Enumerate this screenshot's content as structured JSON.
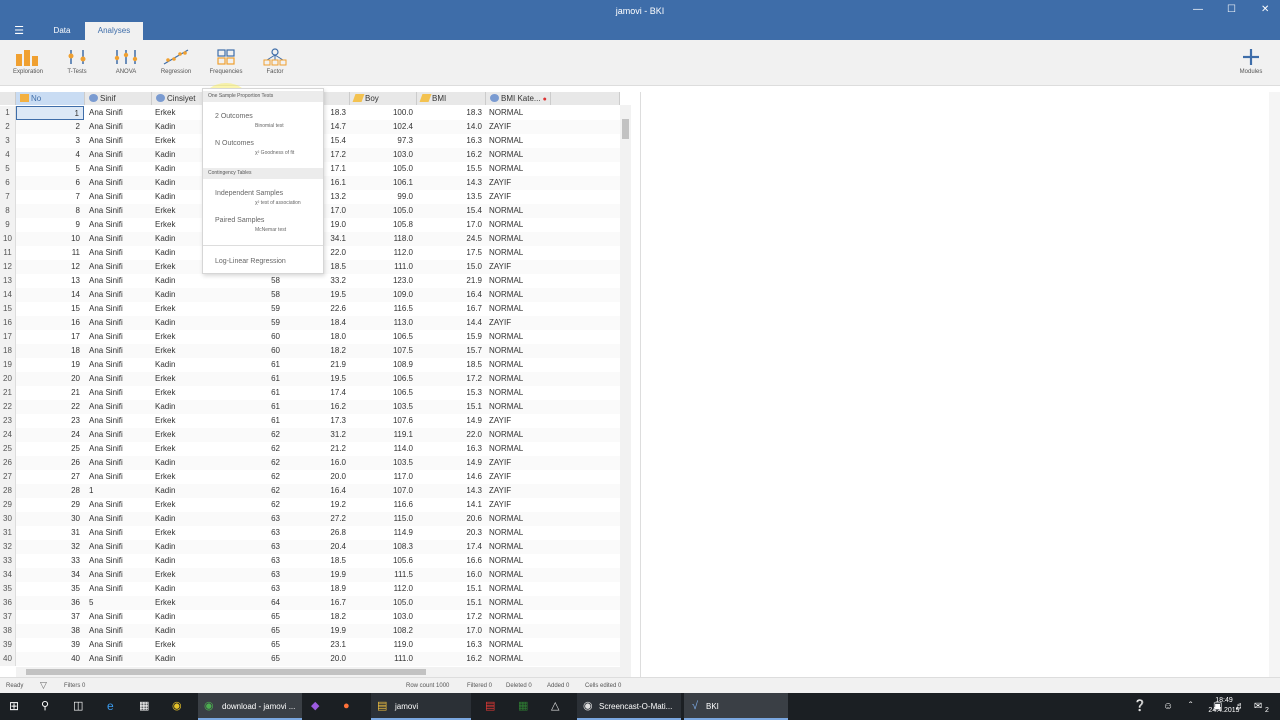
{
  "window": {
    "title": "jamovi - BKI"
  },
  "tabs": [
    {
      "label": "Data",
      "active": false
    },
    {
      "label": "Analyses",
      "active": true
    }
  ],
  "toolbar": {
    "items": [
      {
        "label": "Exploration",
        "icon": "exploration-icon"
      },
      {
        "label": "T-Tests",
        "icon": "t-tests-icon"
      },
      {
        "label": "ANOVA",
        "icon": "anova-icon"
      },
      {
        "label": "Regression",
        "icon": "regression-icon"
      },
      {
        "label": "Frequencies",
        "icon": "frequencies-icon"
      },
      {
        "label": "Factor",
        "icon": "factor-icon"
      }
    ],
    "modules_label": "Modules"
  },
  "columns": [
    {
      "name": "No",
      "type": "id"
    },
    {
      "name": "Sinif",
      "type": "nominal"
    },
    {
      "name": "Cinsiyet",
      "type": "nominal"
    },
    {
      "name": "",
      "type": "continuous"
    },
    {
      "name": "",
      "type": "continuous"
    },
    {
      "name": "Boy",
      "type": "continuous"
    },
    {
      "name": "BMI",
      "type": "continuous"
    },
    {
      "name": "BMI Kate...",
      "type": "nominal"
    }
  ],
  "rows": [
    [
      "1",
      "Ana Sinifi",
      "Erkek",
      "",
      "18.3",
      "100.0",
      "18.3",
      "NORMAL"
    ],
    [
      "2",
      "Ana Sinifi",
      "Kadin",
      "",
      "14.7",
      "102.4",
      "14.0",
      "ZAYIF"
    ],
    [
      "3",
      "Ana Sinifi",
      "Erkek",
      "",
      "15.4",
      "97.3",
      "16.3",
      "NORMAL"
    ],
    [
      "4",
      "Ana Sinifi",
      "Kadin",
      "",
      "17.2",
      "103.0",
      "16.2",
      "NORMAL"
    ],
    [
      "5",
      "Ana Sinifi",
      "Kadin",
      "",
      "17.1",
      "105.0",
      "15.5",
      "NORMAL"
    ],
    [
      "6",
      "Ana Sinifi",
      "Kadin",
      "",
      "16.1",
      "106.1",
      "14.3",
      "ZAYIF"
    ],
    [
      "7",
      "Ana Sinifi",
      "Kadin",
      "",
      "13.2",
      "99.0",
      "13.5",
      "ZAYIF"
    ],
    [
      "8",
      "Ana Sinifi",
      "Erkek",
      "",
      "17.0",
      "105.0",
      "15.4",
      "NORMAL"
    ],
    [
      "9",
      "Ana Sinifi",
      "Erkek",
      "",
      "19.0",
      "105.8",
      "17.0",
      "NORMAL"
    ],
    [
      "10",
      "Ana Sinifi",
      "Kadin",
      "",
      "34.1",
      "118.0",
      "24.5",
      "NORMAL"
    ],
    [
      "11",
      "Ana Sinifi",
      "Kadin",
      "",
      "22.0",
      "112.0",
      "17.5",
      "NORMAL"
    ],
    [
      "12",
      "Ana Sinifi",
      "Erkek",
      "",
      "18.5",
      "111.0",
      "15.0",
      "ZAYIF"
    ],
    [
      "13",
      "Ana Sinifi",
      "Kadin",
      "58",
      "33.2",
      "123.0",
      "21.9",
      "NORMAL"
    ],
    [
      "14",
      "Ana Sinifi",
      "Kadin",
      "58",
      "19.5",
      "109.0",
      "16.4",
      "NORMAL"
    ],
    [
      "15",
      "Ana Sinifi",
      "Erkek",
      "59",
      "22.6",
      "116.5",
      "16.7",
      "NORMAL"
    ],
    [
      "16",
      "Ana Sinifi",
      "Kadin",
      "59",
      "18.4",
      "113.0",
      "14.4",
      "ZAYIF"
    ],
    [
      "17",
      "Ana Sinifi",
      "Erkek",
      "60",
      "18.0",
      "106.5",
      "15.9",
      "NORMAL"
    ],
    [
      "18",
      "Ana Sinifi",
      "Erkek",
      "60",
      "18.2",
      "107.5",
      "15.7",
      "NORMAL"
    ],
    [
      "19",
      "Ana Sinifi",
      "Kadin",
      "61",
      "21.9",
      "108.9",
      "18.5",
      "NORMAL"
    ],
    [
      "20",
      "Ana Sinifi",
      "Erkek",
      "61",
      "19.5",
      "106.5",
      "17.2",
      "NORMAL"
    ],
    [
      "21",
      "Ana Sinifi",
      "Erkek",
      "61",
      "17.4",
      "106.5",
      "15.3",
      "NORMAL"
    ],
    [
      "22",
      "Ana Sinifi",
      "Kadin",
      "61",
      "16.2",
      "103.5",
      "15.1",
      "NORMAL"
    ],
    [
      "23",
      "Ana Sinifi",
      "Erkek",
      "61",
      "17.3",
      "107.6",
      "14.9",
      "ZAYIF"
    ],
    [
      "24",
      "Ana Sinifi",
      "Erkek",
      "62",
      "31.2",
      "119.1",
      "22.0",
      "NORMAL"
    ],
    [
      "25",
      "Ana Sinifi",
      "Erkek",
      "62",
      "21.2",
      "114.0",
      "16.3",
      "NORMAL"
    ],
    [
      "26",
      "Ana Sinifi",
      "Kadin",
      "62",
      "16.0",
      "103.5",
      "14.9",
      "ZAYIF"
    ],
    [
      "27",
      "Ana Sinifi",
      "Erkek",
      "62",
      "20.0",
      "117.0",
      "14.6",
      "ZAYIF"
    ],
    [
      "28",
      "1",
      "Kadin",
      "62",
      "16.4",
      "107.0",
      "14.3",
      "ZAYIF"
    ],
    [
      "29",
      "Ana Sinifi",
      "Erkek",
      "62",
      "19.2",
      "116.6",
      "14.1",
      "ZAYIF"
    ],
    [
      "30",
      "Ana Sinifi",
      "Kadin",
      "63",
      "27.2",
      "115.0",
      "20.6",
      "NORMAL"
    ],
    [
      "31",
      "Ana Sinifi",
      "Erkek",
      "63",
      "26.8",
      "114.9",
      "20.3",
      "NORMAL"
    ],
    [
      "32",
      "Ana Sinifi",
      "Kadin",
      "63",
      "20.4",
      "108.3",
      "17.4",
      "NORMAL"
    ],
    [
      "33",
      "Ana Sinifi",
      "Kadin",
      "63",
      "18.5",
      "105.6",
      "16.6",
      "NORMAL"
    ],
    [
      "34",
      "Ana Sinifi",
      "Erkek",
      "63",
      "19.9",
      "111.5",
      "16.0",
      "NORMAL"
    ],
    [
      "35",
      "Ana Sinifi",
      "Kadin",
      "63",
      "18.9",
      "112.0",
      "15.1",
      "NORMAL"
    ],
    [
      "36",
      "5",
      "Erkek",
      "64",
      "16.7",
      "105.0",
      "15.1",
      "NORMAL"
    ],
    [
      "37",
      "Ana Sinifi",
      "Kadin",
      "65",
      "18.2",
      "103.0",
      "17.2",
      "NORMAL"
    ],
    [
      "38",
      "Ana Sinifi",
      "Kadin",
      "65",
      "19.9",
      "108.2",
      "17.0",
      "NORMAL"
    ],
    [
      "39",
      "Ana Sinifi",
      "Erkek",
      "65",
      "23.1",
      "119.0",
      "16.3",
      "NORMAL"
    ],
    [
      "40",
      "Ana Sinifi",
      "Kadin",
      "65",
      "20.0",
      "111.0",
      "16.2",
      "NORMAL"
    ]
  ],
  "menu": {
    "sections": [
      {
        "header": "One Sample Proportion Tests",
        "items": [
          {
            "label": "2 Outcomes",
            "sub": "Binomial test"
          },
          {
            "label": "N Outcomes",
            "sub": "χ² Goodness of fit"
          }
        ]
      },
      {
        "header": "Contingency Tables",
        "items": [
          {
            "label": "Independent Samples",
            "sub": "χ² test of association"
          },
          {
            "label": "Paired Samples",
            "sub": "McNemar test"
          }
        ]
      }
    ],
    "extra": "Log-Linear Regression"
  },
  "status": {
    "ready": "Ready",
    "filters": "Filters 0",
    "row_count": "Row count 1000",
    "filtered": "Filtered 0",
    "deleted": "Deleted 0",
    "added": "Added 0",
    "cells_edited": "Cells edited 0"
  },
  "taskbar": {
    "apps": [
      {
        "label": "download - jamovi ...",
        "icon": "chrome-icon"
      },
      {
        "label": "jamovi",
        "icon": "file-explorer-icon"
      },
      {
        "label": "Screencast-O-Mati...",
        "icon": "screencast-icon"
      },
      {
        "label": "BKI",
        "icon": "jamovi-icon"
      }
    ],
    "time": "18:49",
    "date": "24.4.2019",
    "notifications": "2"
  },
  "colors": {
    "accent": "#3e6da9",
    "toolbar_bg": "#f1f1f1",
    "taskbar_bg": "#1b1f23"
  }
}
